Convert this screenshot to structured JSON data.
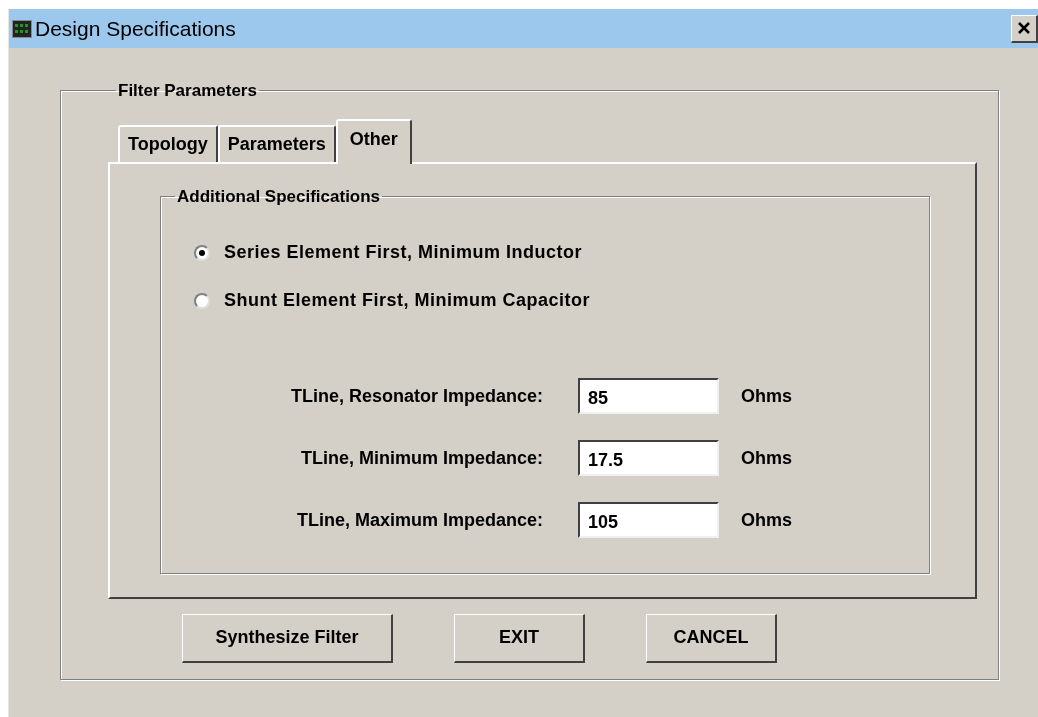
{
  "window": {
    "title": "Design Specifications"
  },
  "group": {
    "title": "Filter Parameters"
  },
  "tabs": [
    {
      "label": "Topology",
      "selected": false
    },
    {
      "label": "Parameters",
      "selected": false
    },
    {
      "label": "Other",
      "selected": true
    }
  ],
  "section": {
    "title": "Additional Specifications"
  },
  "options": [
    {
      "label": "Series Element First, Minimum Inductor",
      "selected": true
    },
    {
      "label": "Shunt Element First, Minimum Capacitor",
      "selected": false
    }
  ],
  "fields": [
    {
      "label": "TLine, Resonator Impedance:",
      "value": "85",
      "unit": "Ohms"
    },
    {
      "label": "TLine, Minimum Impedance:",
      "value": "17.5",
      "unit": "Ohms"
    },
    {
      "label": "TLine, Maximum Impedance:",
      "value": "105",
      "unit": "Ohms"
    }
  ],
  "buttons": [
    "Synthesize Filter",
    "EXIT",
    "CANCEL"
  ]
}
